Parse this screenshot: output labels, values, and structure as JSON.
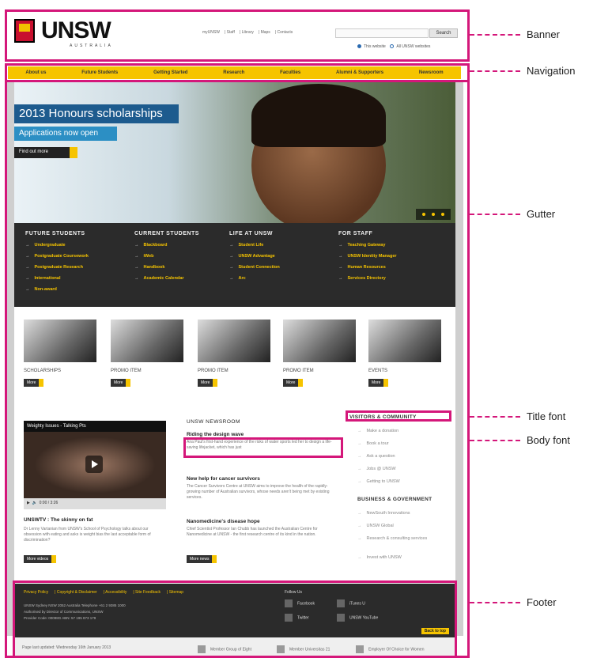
{
  "banner": {
    "logo_text": "UNSW",
    "logo_sub": "AUSTRALIA",
    "utility_links": [
      "myUNSW",
      "Staff",
      "Library",
      "Maps",
      "Contacts"
    ],
    "search_button": "Search",
    "radio_this": "This website",
    "radio_all": "All UNSW websites"
  },
  "nav": [
    "About us",
    "Future Students",
    "Getting Started",
    "Research",
    "Faculties",
    "Alumni & Supporters",
    "Newsroom"
  ],
  "hero": {
    "title": "2013 Honours scholarships",
    "subtitle": "Applications now open",
    "button": "Find out more"
  },
  "panel": {
    "columns": [
      {
        "head": "FUTURE STUDENTS",
        "links": [
          "Undergraduate",
          "Postgraduate Coursework",
          "Postgraduate Research",
          "International",
          "Non-award"
        ]
      },
      {
        "head": "CURRENT STUDENTS",
        "links": [
          "Blackboard",
          "iWeb",
          "Handbook",
          "Academic Calendar"
        ]
      },
      {
        "head": "LIFE AT UNSW",
        "links": [
          "Student Life",
          "UNSW Advantage",
          "Student Connection",
          "Arc"
        ]
      },
      {
        "head": "FOR STAFF",
        "links": [
          "Teaching Gateway",
          "UNSW Identity Manager",
          "Human Resources",
          "Services Directory"
        ]
      }
    ]
  },
  "promos": [
    {
      "title": "SCHOLARSHIPS",
      "more": "More"
    },
    {
      "title": "PROMO ITEM",
      "more": "More"
    },
    {
      "title": "PROMO ITEM",
      "more": "More"
    },
    {
      "title": "PROMO ITEM",
      "more": "More"
    },
    {
      "title": "EVENTS",
      "more": "More"
    }
  ],
  "video": {
    "title": "Weighty Issues - Talking Pts",
    "time": "0:00 / 3:26",
    "caption_head": "UNSWTV : The skinny on fat",
    "caption_body": "Dr Lenny Vartanian from UNSW's School of Psychology talks about our obsession with eating and asks is weight bias the last acceptable form of discrimination?",
    "more": "More videos"
  },
  "news": {
    "head": "UNSW NEWSROOM",
    "items": [
      {
        "title": "Riding the design wave",
        "body": "Ana Paul's first-hand experience of the risks of water sports led her to design a life-saving lifejacket, which has just"
      },
      {
        "title": "New help for cancer survivors",
        "body": "The Cancer Survivors Centre at UNSW aims to improve the health of the rapidly-growing number of Australian survivors, whose needs aren't being met by existing services."
      },
      {
        "title": "Nanomedicine's disease hope",
        "body": "Chief Scientist Professor Ian Chubb has launched the Australian Centre for Nanomedicine at UNSW - the first research centre of its kind in the nation."
      }
    ],
    "more": "More news"
  },
  "side": {
    "visitors_head": "VISITORS & COMMUNITY",
    "visitors": [
      "Make a donation",
      "Book a tour",
      "Ask a question",
      "Jobs @ UNSW",
      "Getting to UNSW"
    ],
    "business_head": "BUSINESS & GOVERNMENT",
    "business": [
      "NewSouth Innovations",
      "UNSW Global",
      "Research & consulting services",
      "Invest with UNSW"
    ]
  },
  "footer": {
    "links": [
      "Privacy Policy",
      "Copyright & Disclaimer",
      "Accessibility",
      "Site Feedback",
      "Sitemap"
    ],
    "address_1": "UNSW Sydney NSW 2052 Australia Telephone +61 2 9385 1000",
    "address_2": "Authorised by Director of Communications, UNSW",
    "address_3": "Provider Code: 00098G ABN: 57 195 873 179",
    "follow": "Follow Us",
    "social": [
      "Facebook",
      "iTunes U",
      "Twitter",
      "UNSW YouTube"
    ],
    "back_top": "Back to top",
    "updated": "Page last updated: Wednesday 16th January 2013",
    "badges": [
      "Member Group of Eight",
      "Member Universitas 21",
      "Employer Of Choice for Women"
    ]
  },
  "callouts": [
    "Banner",
    "Navigation",
    "Gutter",
    "Title font",
    "Body font",
    "Footer"
  ],
  "colors": {
    "highlight": "#d4177a",
    "accent": "#f6c400",
    "dark": "#2b2b2b"
  }
}
